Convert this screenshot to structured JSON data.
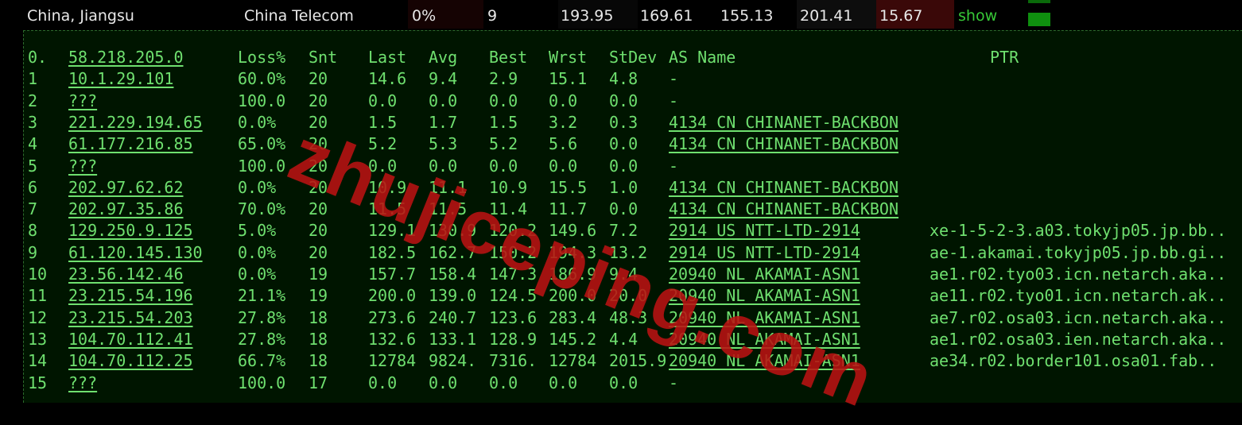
{
  "summary": {
    "location": "China, Jiangsu",
    "isp": "China Telecom",
    "loss": "0%",
    "sent": "9",
    "last": "193.95",
    "avg": "169.61",
    "best": "155.13",
    "worst": "201.41",
    "stdev": "15.67",
    "show_link": "show"
  },
  "colors": {
    "accent_green": "#37c837",
    "terminal_text": "#6fe06f",
    "watermark_red": "#b91212"
  },
  "headers": [
    "Loss%",
    "Snt",
    "Last",
    "Avg",
    "Best",
    "Wrst",
    "StDev",
    "AS Name",
    "PTR"
  ],
  "hops": [
    {
      "hop": "0.",
      "host": "58.218.205.0",
      "loss": "",
      "snt": "",
      "last": "",
      "avg": "",
      "best": "",
      "wrst": "",
      "stdev": "",
      "as": "",
      "ptr": ""
    },
    {
      "hop": "1",
      "host": "10.1.29.101",
      "loss": "60.0%",
      "snt": "20",
      "last": "14.6",
      "avg": "9.4",
      "best": "2.9",
      "wrst": "15.1",
      "stdev": "4.8",
      "as": "-",
      "ptr": ""
    },
    {
      "hop": "2",
      "host": "???",
      "loss": "100.0",
      "snt": "20",
      "last": "0.0",
      "avg": "0.0",
      "best": "0.0",
      "wrst": "0.0",
      "stdev": "0.0",
      "as": "-",
      "ptr": ""
    },
    {
      "hop": "3",
      "host": "221.229.194.65",
      "loss": "0.0%",
      "snt": "20",
      "last": "1.5",
      "avg": "1.7",
      "best": "1.5",
      "wrst": "3.2",
      "stdev": "0.3",
      "as": "4134  CN CHINANET-BACKBON",
      "ptr": ""
    },
    {
      "hop": "4",
      "host": "61.177.216.85",
      "loss": "65.0%",
      "snt": "20",
      "last": "5.2",
      "avg": "5.3",
      "best": "5.2",
      "wrst": "5.6",
      "stdev": "0.0",
      "as": "4134  CN CHINANET-BACKBON",
      "ptr": ""
    },
    {
      "hop": "5",
      "host": "???",
      "loss": "100.0",
      "snt": "20",
      "last": "0.0",
      "avg": "0.0",
      "best": "0.0",
      "wrst": "0.0",
      "stdev": "0.0",
      "as": "-",
      "ptr": ""
    },
    {
      "hop": "6",
      "host": "202.97.62.62",
      "loss": "0.0%",
      "snt": "20",
      "last": "10.9",
      "avg": "11.1",
      "best": "10.9",
      "wrst": "15.5",
      "stdev": "1.0",
      "as": "4134  CN CHINANET-BACKBON",
      "ptr": ""
    },
    {
      "hop": "7",
      "host": "202.97.35.86",
      "loss": "70.0%",
      "snt": "20",
      "last": "11.5",
      "avg": "11.5",
      "best": "11.4",
      "wrst": "11.7",
      "stdev": "0.0",
      "as": "4134  CN CHINANET-BACKBON",
      "ptr": ""
    },
    {
      "hop": "8",
      "host": "129.250.9.125",
      "loss": "5.0%",
      "snt": "20",
      "last": "129.1",
      "avg": "130.9",
      "best": "120.2",
      "wrst": "149.6",
      "stdev": "7.2",
      "as": "2914  US NTT-LTD-2914",
      "ptr": "xe-1-5-2-3.a03.tokyjp05.jp.bb.."
    },
    {
      "hop": "9",
      "host": "61.120.145.130",
      "loss": "0.0%",
      "snt": "20",
      "last": "182.5",
      "avg": "162.7",
      "best": "150.2",
      "wrst": "194.3",
      "stdev": "13.2",
      "as": "2914  US NTT-LTD-2914",
      "ptr": "ae-1.akamai.tokyjp05.jp.bb.gi.."
    },
    {
      "hop": "10",
      "host": "23.56.142.46",
      "loss": "0.0%",
      "snt": "19",
      "last": "157.7",
      "avg": "158.4",
      "best": "147.3",
      "wrst": "186.9",
      "stdev": "9.4",
      "as": "20940 NL AKAMAI-ASN1",
      "ptr": "ae1.r02.tyo03.icn.netarch.aka.."
    },
    {
      "hop": "11",
      "host": "23.215.54.196",
      "loss": "21.1%",
      "snt": "19",
      "last": "200.0",
      "avg": "139.0",
      "best": "124.5",
      "wrst": "200.0",
      "stdev": "20.0",
      "as": "20940 NL AKAMAI-ASN1",
      "ptr": "ae11.r02.tyo01.icn.netarch.ak.."
    },
    {
      "hop": "12",
      "host": "23.215.54.203",
      "loss": "27.8%",
      "snt": "18",
      "last": "273.6",
      "avg": "240.7",
      "best": "123.6",
      "wrst": "283.4",
      "stdev": "48.3",
      "as": "20940 NL AKAMAI-ASN1",
      "ptr": "ae7.r02.osa03.icn.netarch.aka.."
    },
    {
      "hop": "13",
      "host": "104.70.112.41",
      "loss": "27.8%",
      "snt": "18",
      "last": "132.6",
      "avg": "133.1",
      "best": "128.9",
      "wrst": "145.2",
      "stdev": "4.4",
      "as": "20940 NL AKAMAI-ASN1",
      "ptr": "ae1.r02.osa03.ien.netarch.aka.."
    },
    {
      "hop": "14",
      "host": "104.70.112.25",
      "loss": "66.7%",
      "snt": "18",
      "last": "12784",
      "avg": "9824.",
      "best": "7316.",
      "wrst": "12784",
      "stdev": "2015.9",
      "as": "20940 NL AKAMAI-ASN1",
      "ptr": "ae34.r02.border101.osa01.fab.."
    },
    {
      "hop": "15",
      "host": "???",
      "loss": "100.0",
      "snt": "17",
      "last": "0.0",
      "avg": "0.0",
      "best": "0.0",
      "wrst": "0.0",
      "stdev": "0.0",
      "as": "-",
      "ptr": ""
    }
  ],
  "watermark": "zhujiceping.com"
}
